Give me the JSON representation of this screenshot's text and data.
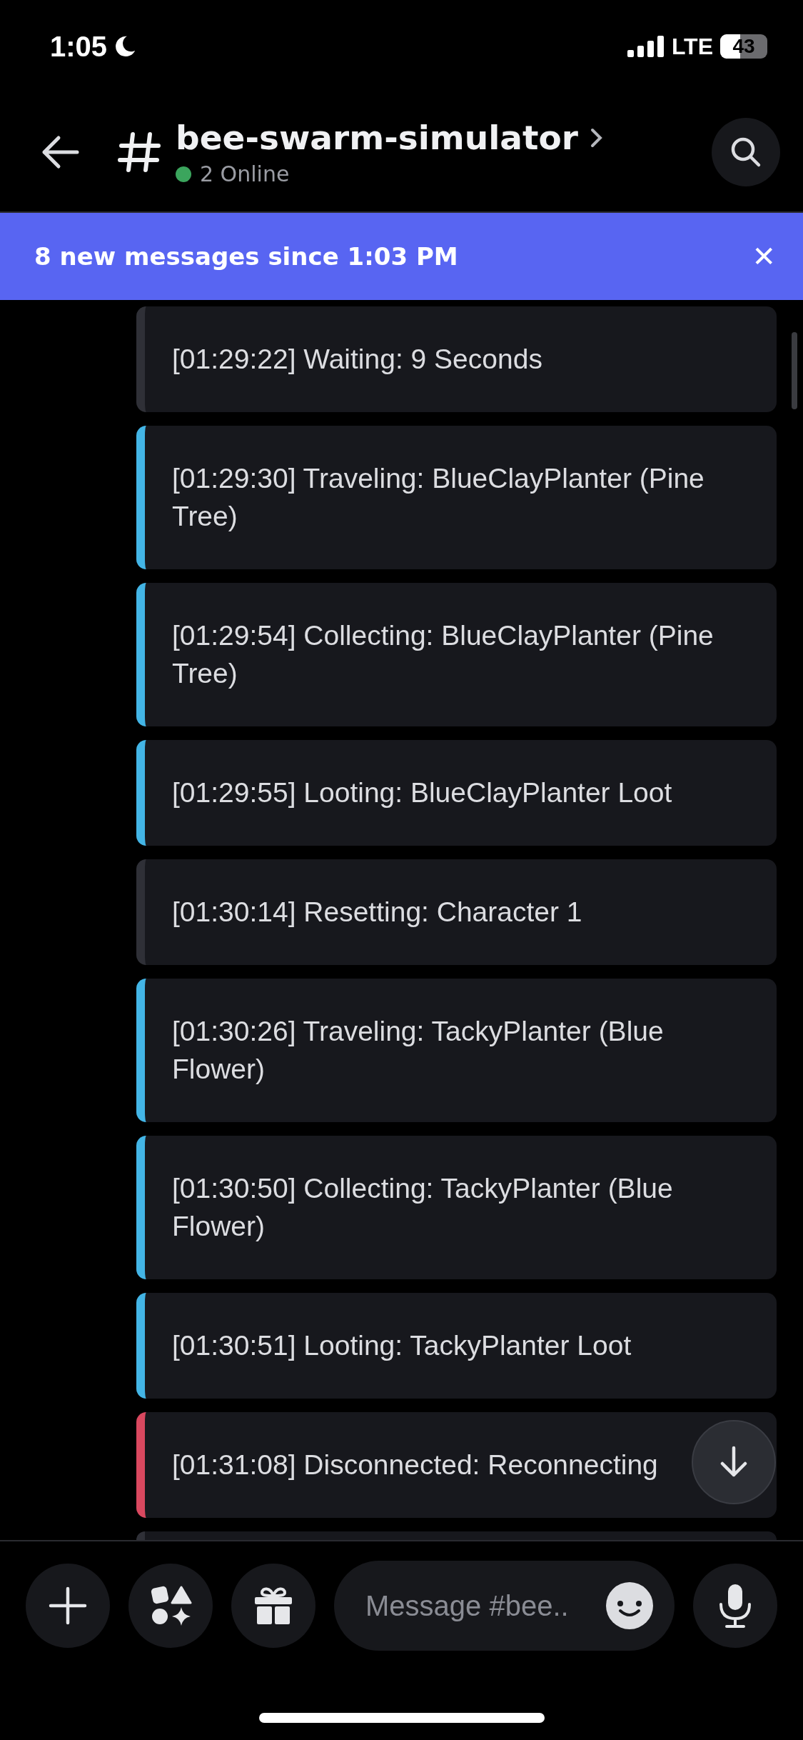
{
  "status_bar": {
    "time": "1:05",
    "network": "LTE",
    "battery": "43"
  },
  "header": {
    "channel": "bee-swarm-simulator",
    "online": "2 Online"
  },
  "banner": {
    "text": "8 new messages since 1:03 PM",
    "close": "✕"
  },
  "messages": [
    {
      "text": "[01:29:22] Waiting: 9 Seconds",
      "color": "#2f3037"
    },
    {
      "text": "[01:29:30] Traveling: BlueClayPlanter (Pine Tree)",
      "color": "#43b5e6"
    },
    {
      "text": "[01:29:54] Collecting: BlueClayPlanter (Pine Tree)",
      "color": "#43b5e6"
    },
    {
      "text": "[01:29:55] Looting: BlueClayPlanter Loot",
      "color": "#43b5e6"
    },
    {
      "text": "[01:30:14] Resetting: Character 1",
      "color": "#2f3037"
    },
    {
      "text": "[01:30:26] Traveling: TackyPlanter (Blue Flower)",
      "color": "#43b5e6"
    },
    {
      "text": "[01:30:50] Collecting: TackyPlanter (Blue Flower)",
      "color": "#43b5e6"
    },
    {
      "text": "[01:30:51] Looting: TackyPlanter Loot",
      "color": "#43b5e6"
    },
    {
      "text": "[01:31:08] Disconnected: Reconnecting",
      "color": "#d9485f"
    },
    {
      "kind": "partial",
      "color": "#2f3037"
    }
  ],
  "composer": {
    "placeholder": "Message #bee.."
  }
}
